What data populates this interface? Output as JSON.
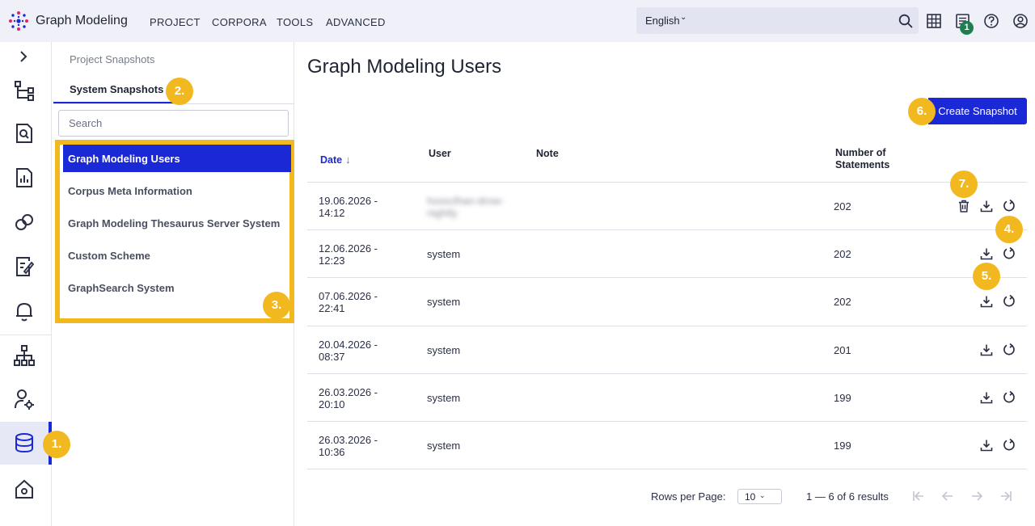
{
  "app": {
    "brand": "Graph Modeling"
  },
  "nav": {
    "items": [
      "PROJECT",
      "CORPORA",
      "TOOLS",
      "ADVANCED"
    ]
  },
  "language": {
    "label": "English"
  },
  "notifications": {
    "count": "1"
  },
  "panel": {
    "tabs": {
      "inactive": "Project Snapshots",
      "active": "System Snapshots"
    },
    "search": {
      "placeholder": "Search"
    },
    "items": [
      {
        "label": "Graph Modeling Users",
        "active": true
      },
      {
        "label": "Corpus Meta Information"
      },
      {
        "label": "Graph Modeling Thesaurus Server System"
      },
      {
        "label": "Custom Scheme"
      },
      {
        "label": "GraphSearch System"
      }
    ]
  },
  "main": {
    "title": "Graph Modeling Users",
    "create_button": "Create Snapshot",
    "columns": {
      "date": "Date",
      "user": "User",
      "note": "Note",
      "statements_line1": "Number of",
      "statements_line2": "Statements"
    },
    "rows": [
      {
        "date1": "19.06.2026 -",
        "date2": "14:12",
        "user1": "hossclhan-drow-",
        "user2": "nightly",
        "statements": "202"
      },
      {
        "date1": "12.06.2026 -",
        "date2": "12:23",
        "user1": "system",
        "user2": "",
        "statements": "202"
      },
      {
        "date1": "07.06.2026 -",
        "date2": "22:41",
        "user1": "system",
        "user2": "",
        "statements": "202"
      },
      {
        "date1": "20.04.2026 -",
        "date2": "08:37",
        "user1": "system",
        "user2": "",
        "statements": "201"
      },
      {
        "date1": "26.03.2026 -",
        "date2": "20:10",
        "user1": "system",
        "user2": "",
        "statements": "199"
      },
      {
        "date1": "26.03.2026 -",
        "date2": "10:36",
        "user1": "system",
        "user2": "",
        "statements": "199"
      }
    ]
  },
  "pagination": {
    "rows_per_page_label": "Rows per Page:",
    "rows_per_page_value": "10",
    "range": "1 — 6 of 6 results"
  },
  "markers": [
    "1.",
    "2.",
    "3.",
    "4.",
    "5.",
    "6.",
    "7."
  ],
  "colors": {
    "accent": "#1a28d6",
    "marker": "#f2b820",
    "badge": "#1e7e4f"
  }
}
